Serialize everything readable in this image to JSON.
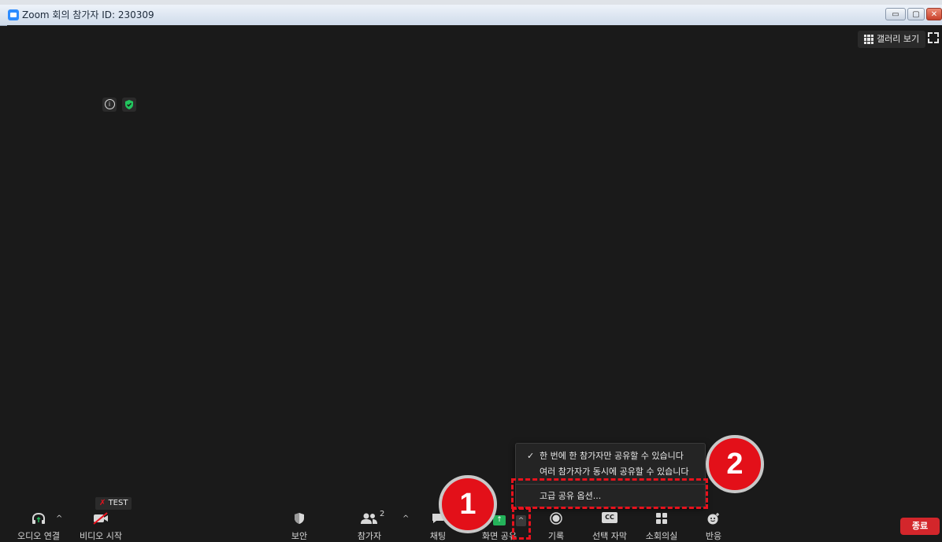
{
  "window": {
    "title": "Zoom 회의 참가자 ID: 230309",
    "minimize": "▭",
    "maximize": "▢",
    "close": "✕"
  },
  "top_right": {
    "gallery_view_label": "갤러리 보기"
  },
  "share_menu": {
    "items": [
      {
        "label": "한 번에 한 참가자만 공유할 수 있습니다",
        "checked": true,
        "check_mark": "✓"
      },
      {
        "label": "여러 참가자가 동시에 공유할 수 있습니다",
        "checked": false
      },
      {
        "label": "고급 공유 옵션..."
      }
    ]
  },
  "annotations": {
    "badge_1": "1",
    "badge_2": "2",
    "highlight_color": "#e8121d"
  },
  "self_view": {
    "name_tag": "TEST"
  },
  "toolbar": {
    "audio_label": "오디오 연결",
    "video_label": "비디오 시작",
    "security_label": "보안",
    "participants_label": "참가자",
    "participants_count": "2",
    "chat_label": "채팅",
    "share_label": "화면 공유",
    "record_label": "기록",
    "captions_label": "선택 자막",
    "captions_icon_text": "CC",
    "breakout_label": "소회의실",
    "reactions_label": "반응",
    "end_label": "종료",
    "caret": "^"
  },
  "colors": {
    "background": "#1a1a1a",
    "share_green": "#24b35a",
    "end_red": "#d3262b",
    "security_green": "#22c55e"
  },
  "icons": [
    "info-icon",
    "shield-check-icon",
    "grid-icon",
    "fullscreen-icon",
    "headphones-icon",
    "video-off-icon",
    "security-shield-icon",
    "participants-icon",
    "chat-icon",
    "share-arrow-icon",
    "record-icon",
    "cc-icon",
    "breakout-icon",
    "reaction-icon",
    "checkmark-icon"
  ]
}
